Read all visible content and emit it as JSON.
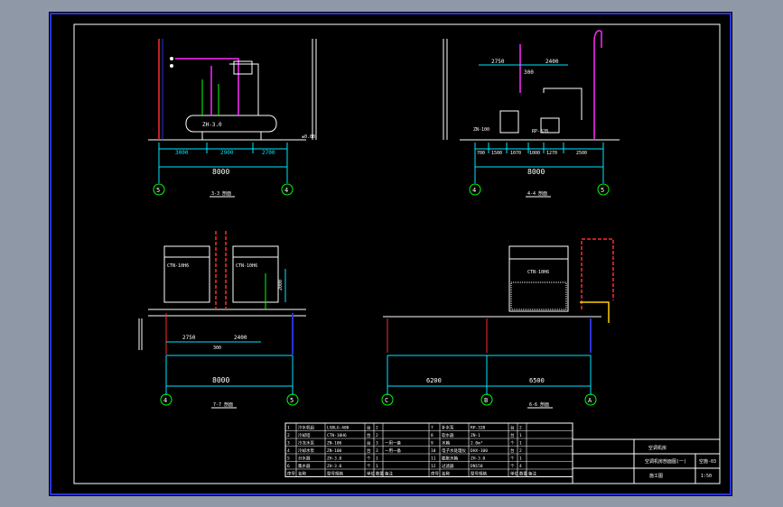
{
  "colors": {
    "app_background": "#8f98a6",
    "paper": "#000000",
    "frame_outer": "#2b34d8",
    "frame_inner": "#ffffff",
    "dim_lines": "#00e6ff",
    "axis_circles": "#00ff00",
    "pipe_magenta": "#ff2bff",
    "pipe_red": "#ff2a2a",
    "equipment": "#ffffff",
    "support": "#ffd000"
  },
  "views": [
    {
      "id": "top-left",
      "name": "3-3 剖面",
      "equipment_label": "ZH-3.0",
      "dims": [
        "3000",
        "2900",
        "2700"
      ],
      "total": "8000",
      "axes": [
        "5",
        "4"
      ],
      "level_mark": "±0.00"
    },
    {
      "id": "top-right",
      "name": "4-4 剖面",
      "top_dims": [
        "2750",
        "2400"
      ],
      "top_total": "300",
      "dims": [
        "700",
        "1500",
        "1070",
        "1000",
        "1270",
        "2500"
      ],
      "total": "8000",
      "axes": [
        "4",
        "5"
      ],
      "pump_labels": [
        "ZN-100",
        "RP-32B"
      ]
    },
    {
      "id": "bottom-left",
      "name": "7-7 剖面",
      "equipment_labels": [
        "CTN-10H6",
        "CTN-10H6"
      ],
      "height_dim": "2000",
      "dims": [
        "2750",
        "2400"
      ],
      "mid_dim": "300",
      "total": "8000",
      "axes": [
        "4",
        "5"
      ]
    },
    {
      "id": "bottom-right",
      "name": "6-6 剖面",
      "equipment_label": "CTN-10H6",
      "dims": [
        "6200",
        "6500"
      ],
      "axes": [
        "C",
        "B",
        "A"
      ]
    }
  ],
  "title_block": {
    "project": "空调机房",
    "sheet_title": "空调机房剖面图(一)",
    "drawing_no": "空施-03",
    "scale": "1:50",
    "stage": "施工图"
  },
  "table": {
    "headers": [
      "序号",
      "名称",
      "型号规格",
      "单位",
      "数量",
      "备注"
    ],
    "rows_left": [
      [
        "1",
        "冷水机组",
        "LSBLG-400",
        "台",
        "2",
        ""
      ],
      [
        "2",
        "冷却塔",
        "CTN-10H6",
        "台",
        "2",
        ""
      ],
      [
        "3",
        "冷冻水泵",
        "ZN-100",
        "台",
        "3",
        "一用一备"
      ],
      [
        "4",
        "冷却水泵",
        "ZN-100",
        "台",
        "3",
        "一用一备"
      ],
      [
        "5",
        "分水器",
        "ZH-3.0",
        "个",
        "1",
        ""
      ],
      [
        "6",
        "集水器",
        "ZH-3.0",
        "个",
        "1",
        ""
      ]
    ],
    "rows_right": [
      [
        "7",
        "补水泵",
        "RP-32B",
        "台",
        "2",
        ""
      ],
      [
        "8",
        "软水器",
        "ZN-1",
        "台",
        "1",
        ""
      ],
      [
        "9",
        "水箱",
        "2.0m³",
        "个",
        "1",
        ""
      ],
      [
        "10",
        "电子水处理仪",
        "DHX-100",
        "台",
        "2",
        ""
      ],
      [
        "11",
        "膨胀水箱",
        "ZH-3.0",
        "个",
        "1",
        ""
      ],
      [
        "12",
        "过滤器",
        "DN150",
        "个",
        "4",
        ""
      ]
    ]
  }
}
